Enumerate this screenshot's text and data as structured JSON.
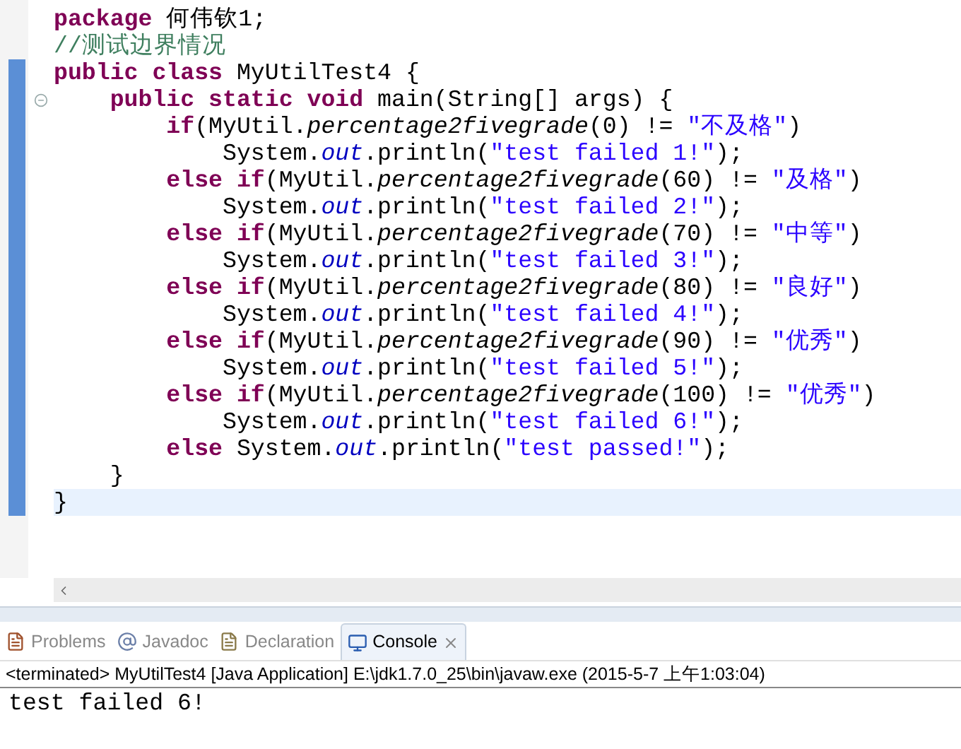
{
  "editor": {
    "lines": [
      {
        "range_marker": false,
        "fold_marker": false,
        "current": false,
        "tokens": [
          {
            "kind": "keyword",
            "text": "package"
          },
          {
            "kind": "plain",
            "text": " 何伟钦1;"
          }
        ]
      },
      {
        "range_marker": false,
        "fold_marker": false,
        "current": false,
        "tokens": [
          {
            "kind": "comment",
            "text": "//测试边界情况"
          }
        ]
      },
      {
        "range_marker": true,
        "fold_marker": false,
        "current": false,
        "tokens": [
          {
            "kind": "keyword",
            "text": "public class"
          },
          {
            "kind": "plain",
            "text": " MyUtilTest4 {"
          }
        ]
      },
      {
        "range_marker": true,
        "fold_marker": true,
        "current": false,
        "tokens": [
          {
            "kind": "keyword",
            "text": "    public static void"
          },
          {
            "kind": "plain",
            "text": " main(String[] args) {"
          }
        ]
      },
      {
        "range_marker": true,
        "fold_marker": false,
        "current": false,
        "tokens": [
          {
            "kind": "keyword",
            "text": "        if"
          },
          {
            "kind": "plain",
            "text": "(MyUtil."
          },
          {
            "kind": "static_method",
            "text": "percentage2fivegrade"
          },
          {
            "kind": "plain",
            "text": "(0) != "
          },
          {
            "kind": "string",
            "text": "\"不及格\""
          },
          {
            "kind": "plain",
            "text": ")"
          }
        ]
      },
      {
        "range_marker": true,
        "fold_marker": false,
        "current": false,
        "tokens": [
          {
            "kind": "plain",
            "text": "            System."
          },
          {
            "kind": "static_field",
            "text": "out"
          },
          {
            "kind": "plain",
            "text": ".println("
          },
          {
            "kind": "string",
            "text": "\"test failed 1!\""
          },
          {
            "kind": "plain",
            "text": ");"
          }
        ]
      },
      {
        "range_marker": true,
        "fold_marker": false,
        "current": false,
        "tokens": [
          {
            "kind": "keyword",
            "text": "        else if"
          },
          {
            "kind": "plain",
            "text": "(MyUtil."
          },
          {
            "kind": "static_method",
            "text": "percentage2fivegrade"
          },
          {
            "kind": "plain",
            "text": "(60) != "
          },
          {
            "kind": "string",
            "text": "\"及格\""
          },
          {
            "kind": "plain",
            "text": ")"
          }
        ]
      },
      {
        "range_marker": true,
        "fold_marker": false,
        "current": false,
        "tokens": [
          {
            "kind": "plain",
            "text": "            System."
          },
          {
            "kind": "static_field",
            "text": "out"
          },
          {
            "kind": "plain",
            "text": ".println("
          },
          {
            "kind": "string",
            "text": "\"test failed 2!\""
          },
          {
            "kind": "plain",
            "text": ");"
          }
        ]
      },
      {
        "range_marker": true,
        "fold_marker": false,
        "current": false,
        "tokens": [
          {
            "kind": "keyword",
            "text": "        else if"
          },
          {
            "kind": "plain",
            "text": "(MyUtil."
          },
          {
            "kind": "static_method",
            "text": "percentage2fivegrade"
          },
          {
            "kind": "plain",
            "text": "(70) != "
          },
          {
            "kind": "string",
            "text": "\"中等\""
          },
          {
            "kind": "plain",
            "text": ")"
          }
        ]
      },
      {
        "range_marker": true,
        "fold_marker": false,
        "current": false,
        "tokens": [
          {
            "kind": "plain",
            "text": "            System."
          },
          {
            "kind": "static_field",
            "text": "out"
          },
          {
            "kind": "plain",
            "text": ".println("
          },
          {
            "kind": "string",
            "text": "\"test failed 3!\""
          },
          {
            "kind": "plain",
            "text": ");"
          }
        ]
      },
      {
        "range_marker": true,
        "fold_marker": false,
        "current": false,
        "tokens": [
          {
            "kind": "keyword",
            "text": "        else if"
          },
          {
            "kind": "plain",
            "text": "(MyUtil."
          },
          {
            "kind": "static_method",
            "text": "percentage2fivegrade"
          },
          {
            "kind": "plain",
            "text": "(80) != "
          },
          {
            "kind": "string",
            "text": "\"良好\""
          },
          {
            "kind": "plain",
            "text": ")"
          }
        ]
      },
      {
        "range_marker": true,
        "fold_marker": false,
        "current": false,
        "tokens": [
          {
            "kind": "plain",
            "text": "            System."
          },
          {
            "kind": "static_field",
            "text": "out"
          },
          {
            "kind": "plain",
            "text": ".println("
          },
          {
            "kind": "string",
            "text": "\"test failed 4!\""
          },
          {
            "kind": "plain",
            "text": ");"
          }
        ]
      },
      {
        "range_marker": true,
        "fold_marker": false,
        "current": false,
        "tokens": [
          {
            "kind": "keyword",
            "text": "        else if"
          },
          {
            "kind": "plain",
            "text": "(MyUtil."
          },
          {
            "kind": "static_method",
            "text": "percentage2fivegrade"
          },
          {
            "kind": "plain",
            "text": "(90) != "
          },
          {
            "kind": "string",
            "text": "\"优秀\""
          },
          {
            "kind": "plain",
            "text": ")"
          }
        ]
      },
      {
        "range_marker": true,
        "fold_marker": false,
        "current": false,
        "tokens": [
          {
            "kind": "plain",
            "text": "            System."
          },
          {
            "kind": "static_field",
            "text": "out"
          },
          {
            "kind": "plain",
            "text": ".println("
          },
          {
            "kind": "string",
            "text": "\"test failed 5!\""
          },
          {
            "kind": "plain",
            "text": ");"
          }
        ]
      },
      {
        "range_marker": true,
        "fold_marker": false,
        "current": false,
        "tokens": [
          {
            "kind": "keyword",
            "text": "        else if"
          },
          {
            "kind": "plain",
            "text": "(MyUtil."
          },
          {
            "kind": "static_method",
            "text": "percentage2fivegrade"
          },
          {
            "kind": "plain",
            "text": "(100) != "
          },
          {
            "kind": "string",
            "text": "\"优秀\""
          },
          {
            "kind": "plain",
            "text": ")"
          }
        ]
      },
      {
        "range_marker": true,
        "fold_marker": false,
        "current": false,
        "tokens": [
          {
            "kind": "plain",
            "text": "            System."
          },
          {
            "kind": "static_field",
            "text": "out"
          },
          {
            "kind": "plain",
            "text": ".println("
          },
          {
            "kind": "string",
            "text": "\"test failed 6!\""
          },
          {
            "kind": "plain",
            "text": ");"
          }
        ]
      },
      {
        "range_marker": true,
        "fold_marker": false,
        "current": false,
        "tokens": [
          {
            "kind": "keyword",
            "text": "        else"
          },
          {
            "kind": "plain",
            "text": " System."
          },
          {
            "kind": "static_field",
            "text": "out"
          },
          {
            "kind": "plain",
            "text": ".println("
          },
          {
            "kind": "string",
            "text": "\"test passed!\""
          },
          {
            "kind": "plain",
            "text": ");"
          }
        ]
      },
      {
        "range_marker": true,
        "fold_marker": false,
        "current": false,
        "tokens": [
          {
            "kind": "plain",
            "text": "    }"
          }
        ]
      },
      {
        "range_marker": true,
        "fold_marker": false,
        "current": true,
        "tokens": [
          {
            "kind": "plain",
            "text": "}"
          }
        ]
      }
    ]
  },
  "panel": {
    "tabs": [
      {
        "kind": "problems",
        "label": "Problems",
        "selected": false
      },
      {
        "kind": "javadoc",
        "label": "Javadoc",
        "selected": false
      },
      {
        "kind": "declaration",
        "label": "Declaration",
        "selected": false
      },
      {
        "kind": "console",
        "label": "Console",
        "selected": true
      }
    ]
  },
  "console": {
    "header": "<terminated> MyUtilTest4 [Java Application] E:\\jdk1.7.0_25\\bin\\javaw.exe (2015-5-7 上午1:03:04)",
    "output": [
      "test failed 6!"
    ]
  }
}
